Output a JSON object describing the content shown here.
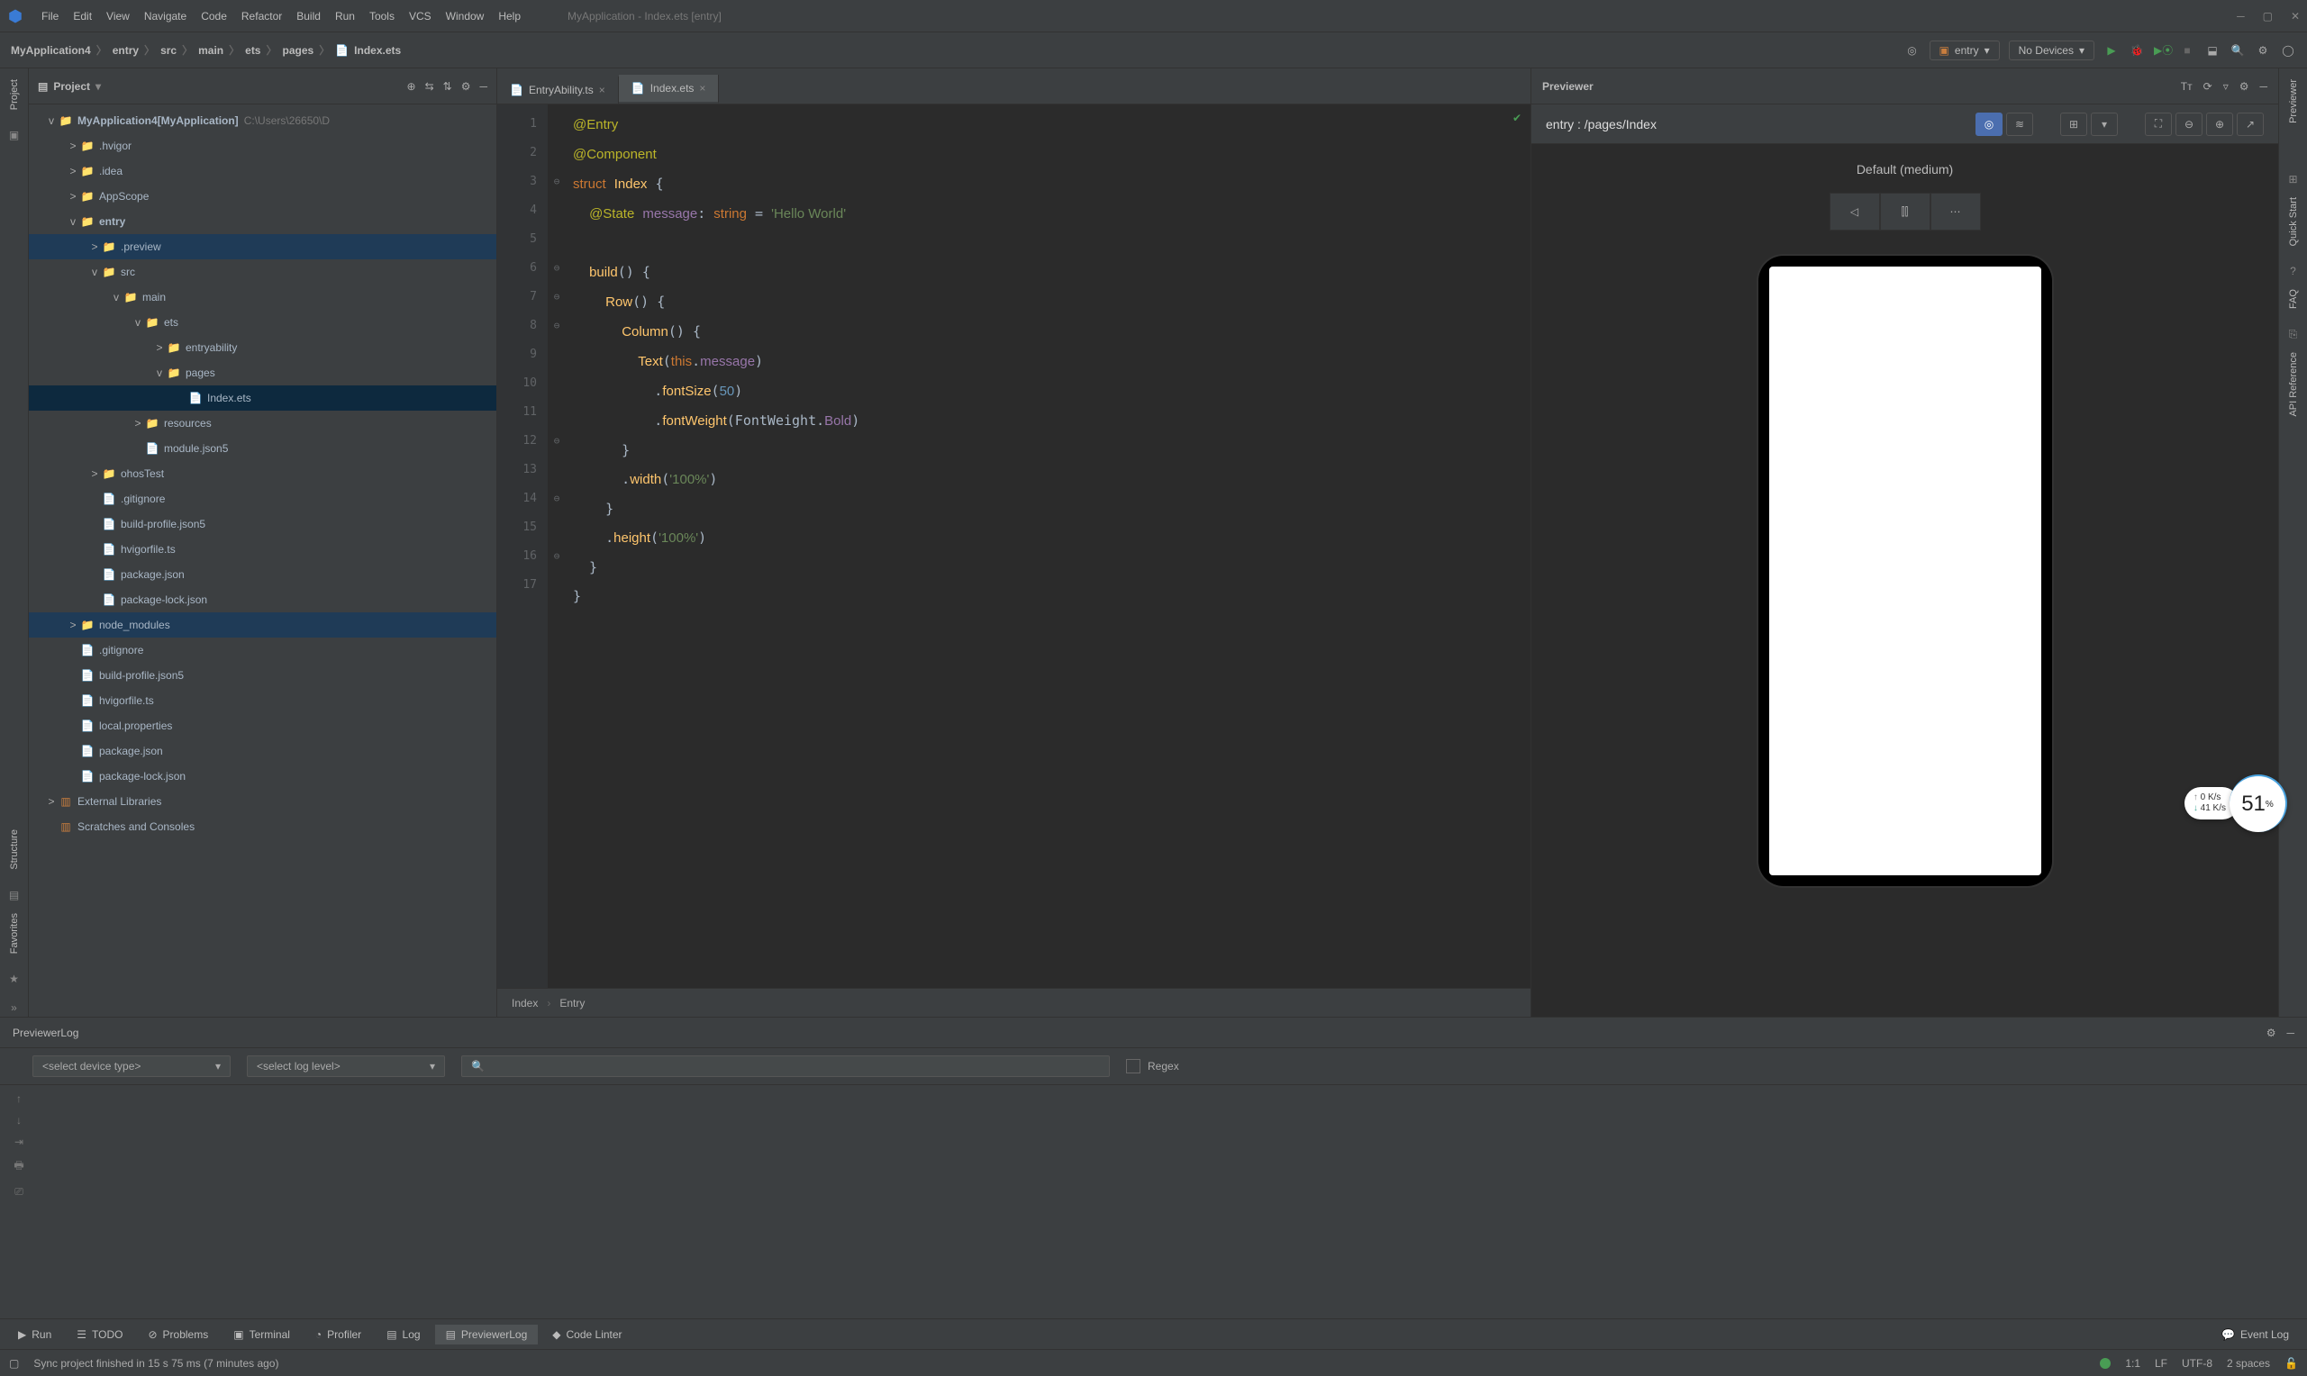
{
  "app": {
    "title": "MyApplication - Index.ets [entry]",
    "menus": [
      "File",
      "Edit",
      "View",
      "Navigate",
      "Code",
      "Refactor",
      "Build",
      "Run",
      "Tools",
      "VCS",
      "Window",
      "Help"
    ]
  },
  "breadcrumbs": [
    "MyApplication4",
    "entry",
    "src",
    "main",
    "ets",
    "pages",
    "Index.ets"
  ],
  "runConfig": {
    "config": "entry",
    "device": "No Devices"
  },
  "projectPane": {
    "title": "Project"
  },
  "tree": {
    "root": {
      "name": "MyApplication4",
      "bold": "[MyApplication]",
      "dim": "C:\\Users\\26650\\D"
    },
    "items": [
      {
        "ind": 1,
        "chev": ">",
        "ic": "📁",
        "cls": "fold-yellow",
        "name": ".hvigor"
      },
      {
        "ind": 1,
        "chev": ">",
        "ic": "📁",
        "cls": "fold-yellow",
        "name": ".idea"
      },
      {
        "ind": 1,
        "chev": ">",
        "ic": "📁",
        "cls": "fold-yellow",
        "name": "AppScope"
      },
      {
        "ind": 1,
        "chev": "v",
        "ic": "📁",
        "cls": "fold-blue",
        "name": "entry",
        "b": true
      },
      {
        "ind": 2,
        "chev": ">",
        "ic": "📁",
        "cls": "fold-orange",
        "name": ".preview",
        "sel2": true
      },
      {
        "ind": 2,
        "chev": "v",
        "ic": "📁",
        "cls": "fold-blue",
        "name": "src"
      },
      {
        "ind": 3,
        "chev": "v",
        "ic": "📁",
        "cls": "fold-blue",
        "name": "main"
      },
      {
        "ind": 4,
        "chev": "v",
        "ic": "📁",
        "cls": "fold-yellow",
        "name": "ets"
      },
      {
        "ind": 5,
        "chev": ">",
        "ic": "📁",
        "cls": "fold-yellow",
        "name": "entryability"
      },
      {
        "ind": 5,
        "chev": "v",
        "ic": "📁",
        "cls": "fold-yellow",
        "name": "pages"
      },
      {
        "ind": 6,
        "chev": "",
        "ic": "📄",
        "cls": "file-ic",
        "name": "Index.ets",
        "sel": true
      },
      {
        "ind": 4,
        "chev": ">",
        "ic": "📁",
        "cls": "fold-yellow",
        "name": "resources"
      },
      {
        "ind": 4,
        "chev": "",
        "ic": "📄",
        "cls": "file-ic",
        "name": "module.json5"
      },
      {
        "ind": 2,
        "chev": ">",
        "ic": "📁",
        "cls": "fold-blue",
        "name": "ohosTest"
      },
      {
        "ind": 2,
        "chev": "",
        "ic": "📄",
        "cls": "file-ic",
        "name": ".gitignore"
      },
      {
        "ind": 2,
        "chev": "",
        "ic": "📄",
        "cls": "file-ic",
        "name": "build-profile.json5"
      },
      {
        "ind": 2,
        "chev": "",
        "ic": "📄",
        "cls": "file-ic",
        "name": "hvigorfile.ts"
      },
      {
        "ind": 2,
        "chev": "",
        "ic": "📄",
        "cls": "file-ic",
        "name": "package.json"
      },
      {
        "ind": 2,
        "chev": "",
        "ic": "📄",
        "cls": "file-ic",
        "name": "package-lock.json"
      },
      {
        "ind": 1,
        "chev": ">",
        "ic": "📁",
        "cls": "fold-orange",
        "name": "node_modules",
        "sel2": true
      },
      {
        "ind": 1,
        "chev": "",
        "ic": "📄",
        "cls": "file-ic",
        "name": ".gitignore"
      },
      {
        "ind": 1,
        "chev": "",
        "ic": "📄",
        "cls": "file-ic",
        "name": "build-profile.json5"
      },
      {
        "ind": 1,
        "chev": "",
        "ic": "📄",
        "cls": "file-ic",
        "name": "hvigorfile.ts"
      },
      {
        "ind": 1,
        "chev": "",
        "ic": "📄",
        "cls": "file-ic",
        "name": "local.properties"
      },
      {
        "ind": 1,
        "chev": "",
        "ic": "📄",
        "cls": "file-ic",
        "name": "package.json"
      },
      {
        "ind": 1,
        "chev": "",
        "ic": "📄",
        "cls": "file-ic",
        "name": "package-lock.json"
      }
    ],
    "ext1": "External Libraries",
    "ext2": "Scratches and Consoles"
  },
  "tabs": [
    {
      "name": "EntryAbility.ts",
      "active": false
    },
    {
      "name": "Index.ets",
      "active": true
    }
  ],
  "code": {
    "lines": [
      {
        "n": 1,
        "html": "<span class='k-ann'>@Entry</span>"
      },
      {
        "n": 2,
        "html": "<span class='k-ann'>@Component</span>"
      },
      {
        "n": 3,
        "html": "<span class='k-kw'>struct</span> <span class='k-ty'>Index</span> {"
      },
      {
        "n": 4,
        "html": "  <span class='k-ann'>@State</span> <span class='k-prop'>message</span>: <span class='k-kw'>string</span> = <span class='k-str'>'Hello World'</span>"
      },
      {
        "n": 5,
        "html": ""
      },
      {
        "n": 6,
        "html": "  <span class='k-func'>build</span>() {"
      },
      {
        "n": 7,
        "html": "    <span class='k-func'>Row</span>() {"
      },
      {
        "n": 8,
        "html": "      <span class='k-func'>Column</span>() {"
      },
      {
        "n": 9,
        "html": "        <span class='k-func'>Text</span>(<span class='k-kw'>this</span>.<span class='k-prop'>message</span>)"
      },
      {
        "n": 10,
        "html": "          .<span class='k-func'>fontSize</span>(<span class='k-num'>50</span>)"
      },
      {
        "n": 11,
        "html": "          .<span class='k-func'>fontWeight</span>(FontWeight.<span class='k-prop'>Bold</span>)"
      },
      {
        "n": 12,
        "html": "      }"
      },
      {
        "n": 13,
        "html": "      .<span class='k-func'>width</span>(<span class='k-str'>'100%'</span>)"
      },
      {
        "n": 14,
        "html": "    }"
      },
      {
        "n": 15,
        "html": "    .<span class='k-func'>height</span>(<span class='k-str'>'100%'</span>)"
      },
      {
        "n": 16,
        "html": "  }"
      },
      {
        "n": 17,
        "html": "}"
      }
    ],
    "folds": [
      "",
      "",
      "⊖",
      "",
      "",
      "⊖",
      "⊖",
      "⊖",
      "",
      "",
      "",
      "⊖",
      "",
      "⊖",
      "",
      "⊖",
      ""
    ]
  },
  "editorCrumbs": [
    "Index",
    "Entry"
  ],
  "previewer": {
    "title": "Previewer",
    "entry": "entry : /pages/Index",
    "profile": "Default (medium)"
  },
  "net": {
    "up": "0  K/s",
    "down": "41  K/s",
    "pct": "51"
  },
  "plog": {
    "title": "PreviewerLog",
    "deviceSel": "<select device type>",
    "logSel": "<select log level>",
    "searchPlaceholder": "",
    "regex": "Regex"
  },
  "bottomTabs": [
    {
      "ic": "▶",
      "name": "Run"
    },
    {
      "ic": "☰",
      "name": "TODO"
    },
    {
      "ic": "⊘",
      "name": "Problems"
    },
    {
      "ic": "▣",
      "name": "Terminal"
    },
    {
      "ic": "◔",
      "name": "Profiler"
    },
    {
      "ic": "▤",
      "name": "Log"
    },
    {
      "ic": "▤",
      "name": "PreviewerLog",
      "active": true
    },
    {
      "ic": "◆",
      "name": "Code Linter"
    }
  ],
  "eventLog": "Event Log",
  "status": {
    "msg": "Sync project finished in 15 s 75 ms (7 minutes ago)",
    "pos": "1:1",
    "le": "LF",
    "enc": "UTF-8",
    "indent": "2 spaces"
  },
  "rails": {
    "left": [
      "Project",
      "Structure",
      "Favorites"
    ],
    "right": [
      "Previewer",
      "Quick Start",
      "FAQ",
      "API Reference"
    ]
  }
}
